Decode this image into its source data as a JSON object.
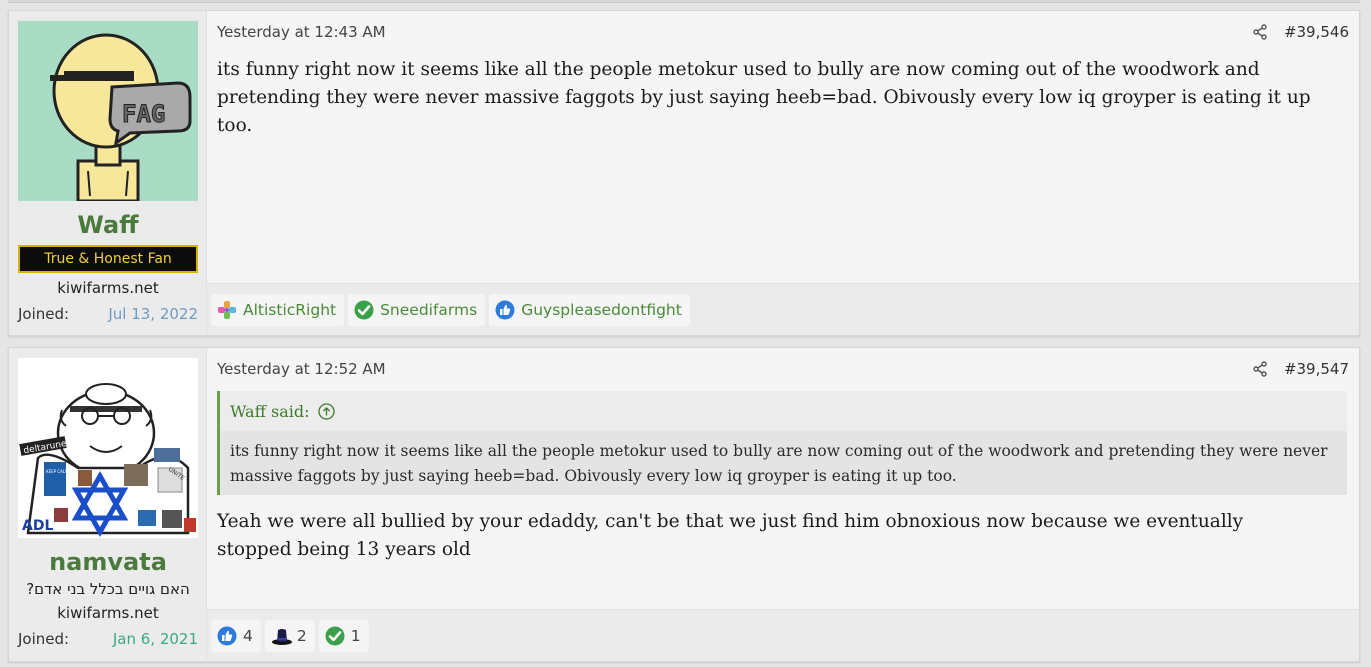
{
  "posts": [
    {
      "username": "Waff",
      "user_title": "True & Honest Fan",
      "site": "kiwifarms.net",
      "joined_label": "Joined:",
      "joined_date": "Jul 13, 2022",
      "avatar_text": "FAG",
      "date": "Yesterday at 12:43 AM",
      "post_number": "#39,546",
      "body": "its funny right now it seems like all the people metokur used to bully are now coming out of the woodwork and pretending they were never massive faggots by just saying heeb=bad. Obivously every low iq groyper is eating it up too.",
      "reactions": [
        {
          "icon": "colorful-flower-icon",
          "label": "AltisticRight"
        },
        {
          "icon": "green-check-icon",
          "label": "Sneedifarms"
        },
        {
          "icon": "thumbs-up-icon",
          "label": "Guyspleasedontfight"
        }
      ]
    },
    {
      "username": "namvata",
      "user_subtitle": "האם גויים בכלל בני אדם?",
      "site": "kiwifarms.net",
      "joined_label": "Joined:",
      "joined_date": "Jan 6, 2021",
      "avatar_text": {
        "deltarune": "deltarune",
        "keep_calm": "KEEP CALM AND DESTROY HAMAS",
        "adl": "ADL",
        "unite": "UNITE"
      },
      "date": "Yesterday at 12:52 AM",
      "post_number": "#39,547",
      "quote": {
        "author": "Waff said:",
        "text": "its funny right now it seems like all the people metokur used to bully are now coming out of the woodwork and pretending they were never massive faggots by just saying heeb=bad. Obivously every low iq groyper is eating it up too."
      },
      "body": "Yeah we were all bullied by your edaddy, can't be that we just find him obnoxious now because we eventually stopped being 13 years old",
      "reactions": [
        {
          "icon": "thumbs-up-icon",
          "count": "4"
        },
        {
          "icon": "top-hat-icon",
          "count": "2"
        },
        {
          "icon": "green-check-icon",
          "count": "1"
        }
      ]
    }
  ],
  "colors": {
    "username": "#4a7a3c",
    "badge_bg": "#0c0c0c",
    "badge_text": "#f1d03a",
    "joined_blue": "#6d9bc3",
    "joined_green": "#3aaa84",
    "quote_border": "#6aa04a"
  }
}
